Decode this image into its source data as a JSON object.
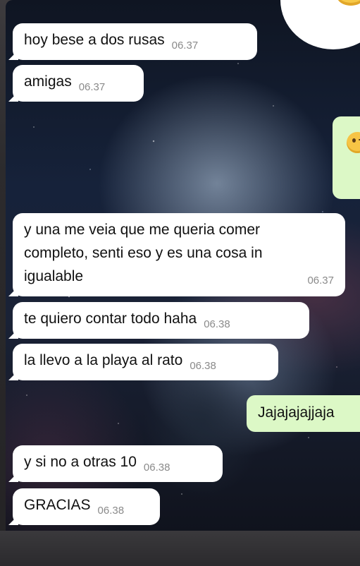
{
  "messages": [
    {
      "text": "hoy bese a dos rusas",
      "time": "06.37"
    },
    {
      "text": "amigas",
      "time": "06.37"
    },
    {
      "line1": "y una me veia que me queria comer",
      "line2": "completo, senti eso y es una cosa in",
      "line3": "igualable",
      "time": "06.37"
    },
    {
      "text": "te quiero contar todo haha",
      "time": "06.38"
    },
    {
      "text": "la llevo a la playa al rato",
      "time": "06.38"
    },
    {
      "text": "y si no a otras 10",
      "time": "06.38"
    },
    {
      "text": "GRACIAS",
      "time": "06.38"
    }
  ],
  "outgoing": {
    "laugh_text": "Jajajajajjaja",
    "emoji": "smirking-face"
  },
  "colors": {
    "incoming_bubble": "#ffffff",
    "outgoing_bubble": "#dcf8c6",
    "timestamp": "#8a8a8a"
  }
}
